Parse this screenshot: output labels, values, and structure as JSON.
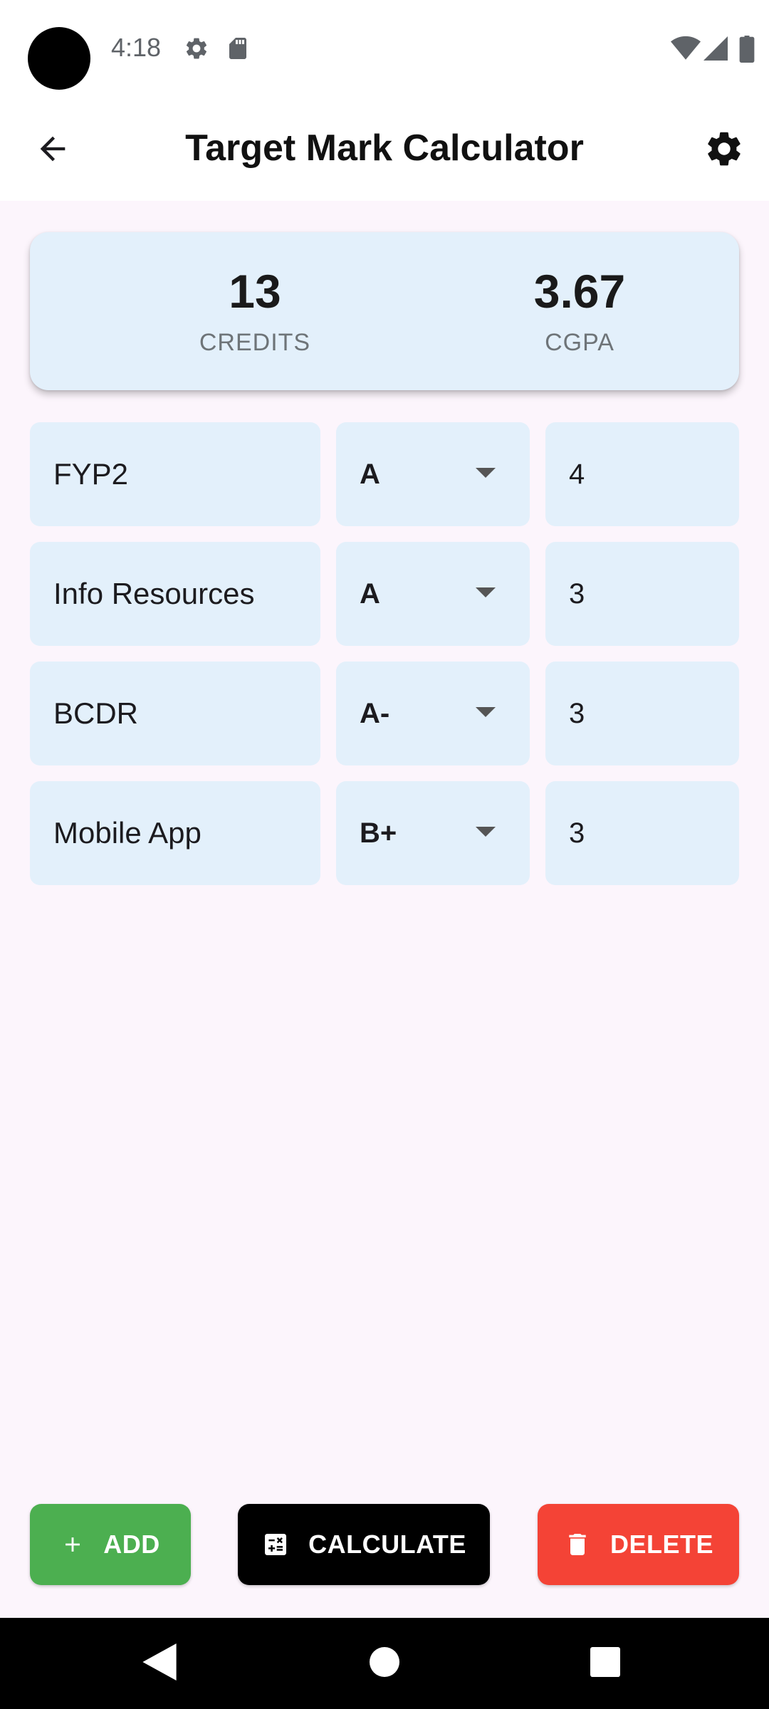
{
  "status_bar": {
    "time": "4:18",
    "icons": [
      "settings-icon",
      "sd-card-icon",
      "wifi-icon",
      "signal-icon",
      "battery-icon"
    ]
  },
  "app_bar": {
    "title": "Target Mark Calculator",
    "back_icon": "arrow-back-icon",
    "settings_icon": "gear-icon"
  },
  "summary": {
    "credits_value": "13",
    "credits_label": "CREDITS",
    "cgpa_value": "3.67",
    "cgpa_label": "CGPA"
  },
  "courses": [
    {
      "name": "FYP2",
      "grade": "A",
      "credit": "4"
    },
    {
      "name": "Info Resources",
      "grade": "A",
      "credit": "3"
    },
    {
      "name": "BCDR",
      "grade": "A-",
      "credit": "3"
    },
    {
      "name": "Mobile App",
      "grade": "B+",
      "credit": "3"
    }
  ],
  "actions": {
    "add_label": "ADD",
    "calculate_label": "CALCULATE",
    "delete_label": "DELETE"
  },
  "colors": {
    "background": "#fcf5fc",
    "card": "#e3f0fb",
    "add": "#4caf50",
    "calculate": "#000000",
    "delete": "#f44336"
  }
}
